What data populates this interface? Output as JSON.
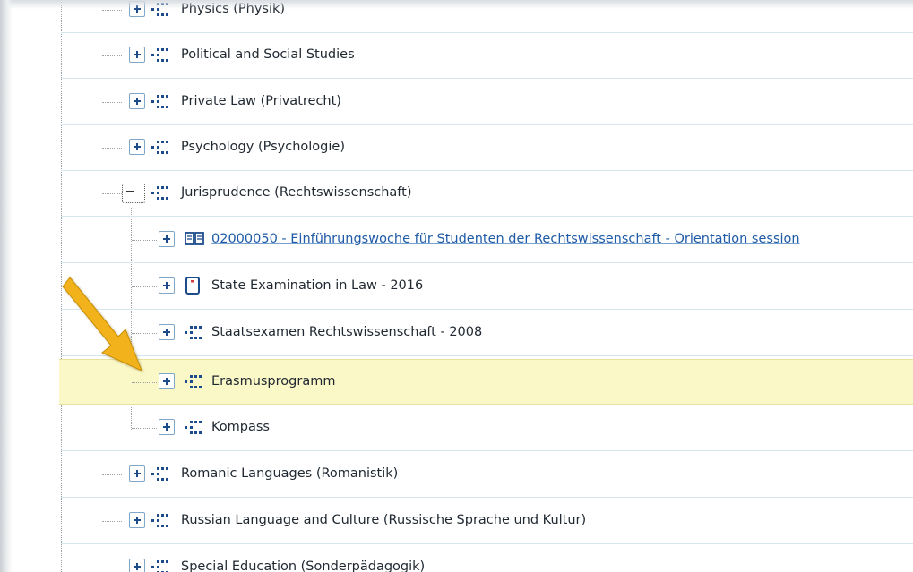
{
  "tree": {
    "rows": [
      {
        "label": "Physics (Physik)",
        "expanded": false,
        "icon": "module-group-icon",
        "level": 0
      },
      {
        "label": "Political and Social Studies",
        "expanded": false,
        "icon": "module-group-icon",
        "level": 0
      },
      {
        "label": "Private Law (Privatrecht)",
        "expanded": false,
        "icon": "module-group-icon",
        "level": 0
      },
      {
        "label": "Psychology (Psychologie)",
        "expanded": false,
        "icon": "module-group-icon",
        "level": 0
      },
      {
        "label": "Jurisprudence (Rechtswissenschaft)",
        "expanded": true,
        "icon": "module-group-icon",
        "level": 0
      },
      {
        "label": "02000050 - Einführungswoche für Studenten der Rechtswissenschaft - Orientation session",
        "expanded": false,
        "icon": "course-book-icon",
        "level": 1
      },
      {
        "label": "State Examination in Law - 2016",
        "expanded": false,
        "icon": "exam-document-icon",
        "level": 1
      },
      {
        "label": "Staatsexamen Rechtswissenschaft - 2008",
        "expanded": false,
        "icon": "module-group-icon",
        "level": 1
      },
      {
        "label": "Erasmusprogramm",
        "expanded": false,
        "icon": "module-group-icon",
        "level": 1,
        "highlighted": true
      },
      {
        "label": "Kompass",
        "expanded": false,
        "icon": "module-group-icon",
        "level": 1
      },
      {
        "label": "Romanic Languages (Romanistik)",
        "expanded": false,
        "icon": "module-group-icon",
        "level": 0
      },
      {
        "label": "Russian Language and Culture (Russische Sprache und Kultur)",
        "expanded": false,
        "icon": "module-group-icon",
        "level": 0
      },
      {
        "label": "Special Education (Sonderpädagogik)",
        "expanded": false,
        "icon": "module-group-icon",
        "level": 0
      }
    ]
  },
  "annotation": {
    "icon": "yellow-arrow-icon",
    "color": "#f2b21c"
  },
  "colors": {
    "highlight": "#fbf8c8",
    "link": "#1e5aa6",
    "icon_blue": "#1c4b8b",
    "exam_red": "#d23b3b"
  }
}
